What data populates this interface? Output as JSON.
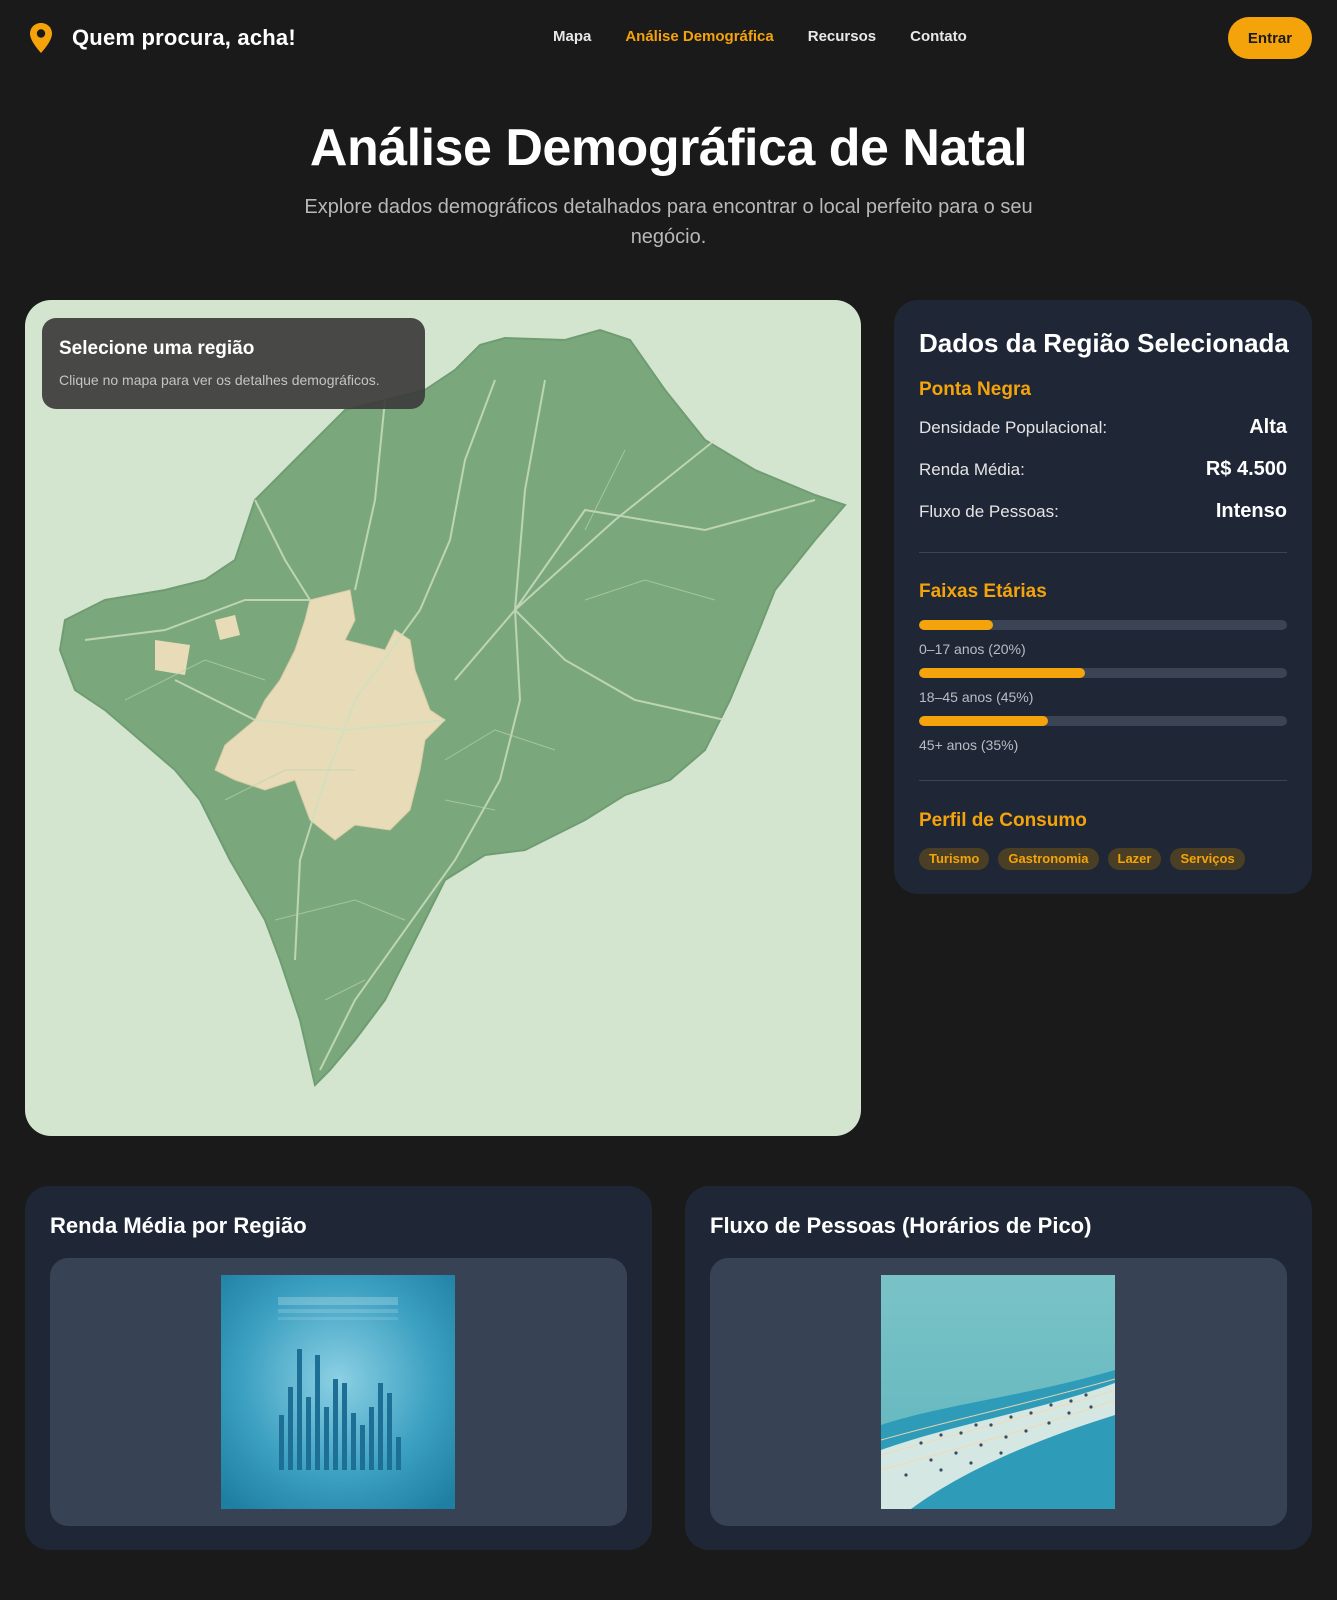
{
  "header": {
    "brand_name": "Quem procura, acha!",
    "brand_icon": "map-pin-icon",
    "nav": [
      {
        "label": "Mapa",
        "active": false
      },
      {
        "label": "Análise Demográfica",
        "active": true
      },
      {
        "label": "Recursos",
        "active": false
      },
      {
        "label": "Contato",
        "active": false
      }
    ],
    "login_label": "Entrar"
  },
  "hero": {
    "title": "Análise Demográfica de Natal",
    "subtitle": "Explore dados demográficos detalhados para encontrar o local perfeito para o seu negócio."
  },
  "map": {
    "overlay_title": "Selecione uma região",
    "overlay_text": "Clique no mapa para ver os detalhes demográficos."
  },
  "region": {
    "title": "Dados da Região Selecionada",
    "name": "Ponta Negra",
    "stats": [
      {
        "label": "Densidade Populacional:",
        "value": "Alta"
      },
      {
        "label": "Renda Média:",
        "value": "R$ 4.500"
      },
      {
        "label": "Fluxo de Pessoas:",
        "value": "Intenso"
      }
    ],
    "age_title": "Faixas Etárias",
    "age_groups": [
      {
        "label": "0–17 anos (20%)",
        "percent": 20
      },
      {
        "label": "18–45 anos (45%)",
        "percent": 45
      },
      {
        "label": "45+ anos (35%)",
        "percent": 35
      }
    ],
    "consumption_title": "Perfil de Consumo",
    "tags": [
      "Turismo",
      "Gastronomia",
      "Lazer",
      "Serviços"
    ]
  },
  "charts": {
    "income_title": "Renda Média por Região",
    "flow_title": "Fluxo de Pessoas (Horários de Pico)"
  },
  "colors": {
    "accent": "#f5a30a",
    "panel": "#1f2736",
    "background": "#1a1a1a",
    "map_land": "#7aa87c",
    "map_urban": "#e8dcb8"
  }
}
